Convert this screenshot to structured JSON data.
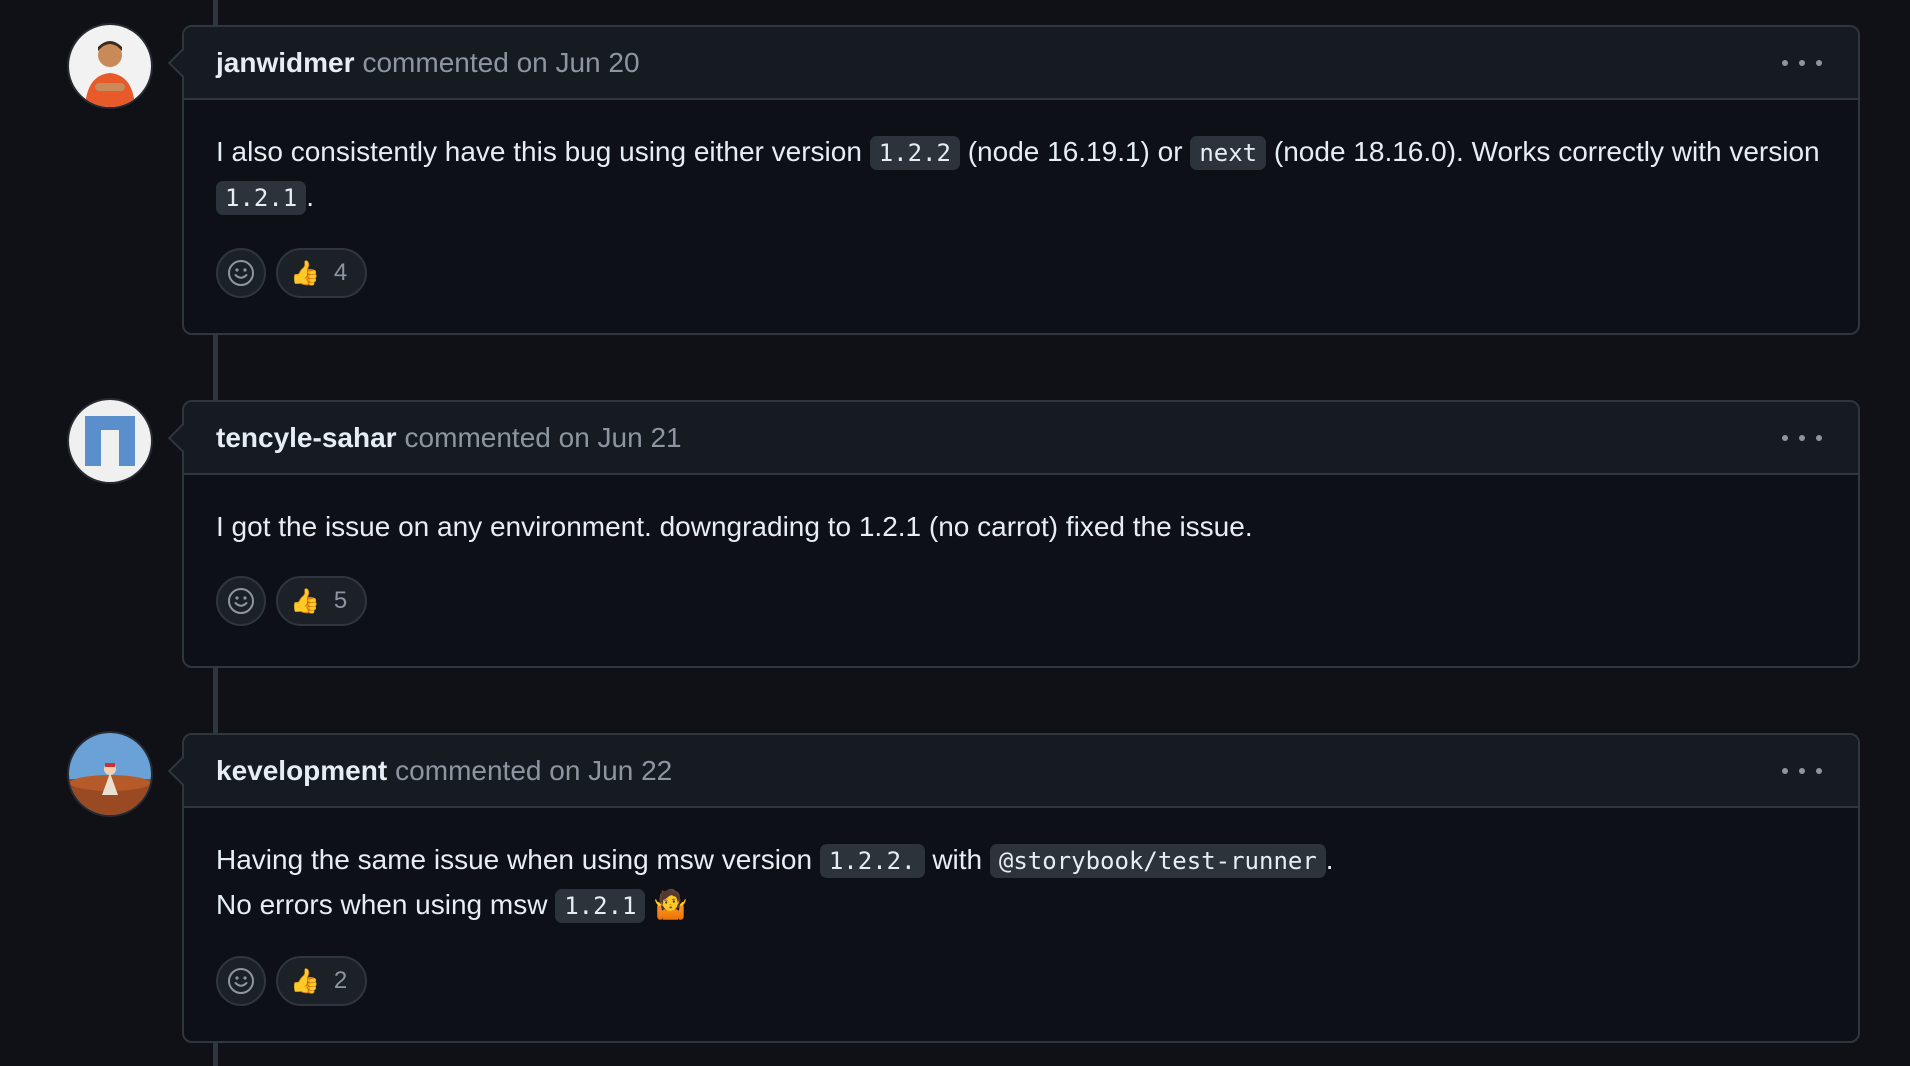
{
  "comments": [
    {
      "author": "janwidmer",
      "action": "commented",
      "date": "on Jun 20",
      "body": {
        "t1": "I also consistently have this bug using either version ",
        "c1": "1.2.2",
        "t2": " (node 16.19.1) or ",
        "c2": "next",
        "t3": " (node 18.16.0). Works correctly with version ",
        "c3": "1.2.1",
        "t4": "."
      },
      "reaction": {
        "emoji": "👍",
        "count": "4"
      },
      "avatar_icon": "person-avatar-icon"
    },
    {
      "author": "tencyle-sahar",
      "action": "commented",
      "date": "on Jun 21",
      "body": {
        "t1": "I got the issue on any environment. downgrading to 1.2.1 (no carrot) fixed the issue."
      },
      "reaction": {
        "emoji": "👍",
        "count": "5"
      },
      "avatar_icon": "identicon-avatar-icon"
    },
    {
      "author": "kevelopment",
      "action": "commented",
      "date": "on Jun 22",
      "body": {
        "t1": "Having the same issue when using msw version ",
        "c1": "1.2.2.",
        "t2": " with ",
        "c2": "@storybook/test-runner",
        "t3": ".",
        "t4": "No errors when using msw ",
        "c3": "1.2.1",
        "t5": " 🤷"
      },
      "reaction": {
        "emoji": "👍",
        "count": "2"
      },
      "avatar_icon": "landscape-avatar-icon"
    }
  ],
  "colors": {
    "background": "#0f1117",
    "header_bg": "#161b22",
    "border": "#30363d",
    "muted_text": "#8d96a0",
    "code_bg": "#2d333b"
  }
}
